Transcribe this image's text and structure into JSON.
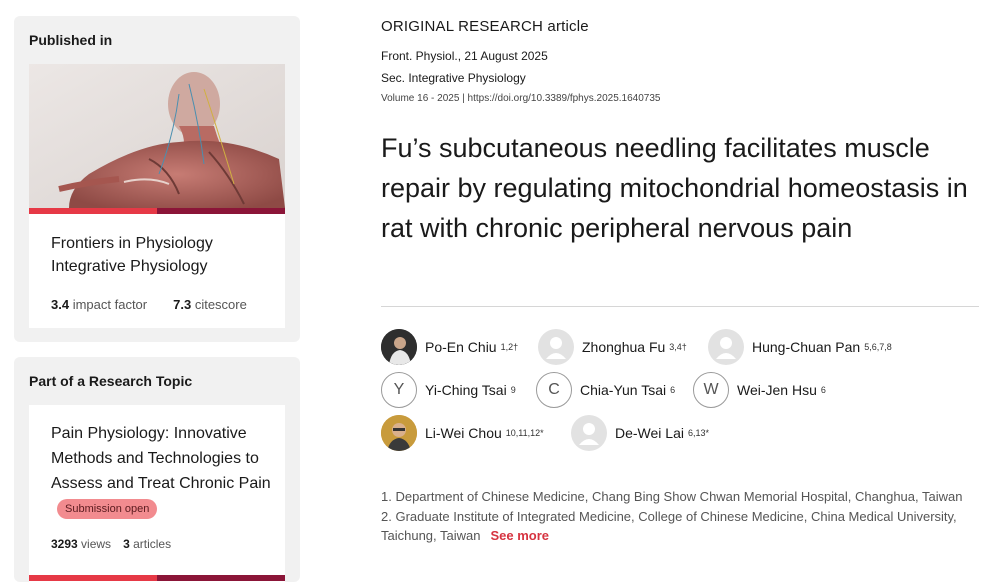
{
  "sidebar": {
    "published": {
      "heading": "Published in",
      "journal": "Frontiers in Physiology",
      "section": "Integrative Physiology",
      "impact_value": "3.4",
      "impact_label": "impact factor",
      "citescore_value": "7.3",
      "citescore_label": "citescore",
      "cover_icon": "anatomy-cover-image"
    },
    "topic": {
      "heading": "Part of a Research Topic",
      "title": "Pain Physiology: Innovative Methods and Technologies to Assess and Treat Chronic Pain",
      "badge": "Submission open",
      "views_value": "3293",
      "views_label": "views",
      "articles_value": "3",
      "articles_label": "articles"
    }
  },
  "article": {
    "type": "ORIGINAL RESEARCH article",
    "journal_date": "Front. Physiol., 21 August 2025",
    "section": "Sec. Integrative Physiology",
    "volume": "Volume 16 - 2025 |",
    "doi": "https://doi.org/10.3389/fphys.2025.1640735",
    "title": "Fu’s subcutaneous needling facilitates muscle repair by regulating mitochondrial homeostasis in rat with chronic peripheral nervous pain"
  },
  "authors": [
    {
      "name": "Po-En Chiu",
      "aff": "1,2†",
      "avatar": "photo"
    },
    {
      "name": "Zhonghua Fu",
      "aff": "3,4†",
      "avatar": "default"
    },
    {
      "name": "Hung-Chuan Pan",
      "aff": "5,6,7,8",
      "avatar": "default"
    },
    {
      "name": "Yi-Ching Tsai",
      "aff": "9",
      "avatar": "Y"
    },
    {
      "name": "Chia-Yun Tsai",
      "aff": "6",
      "avatar": "C"
    },
    {
      "name": "Wei-Jen Hsu",
      "aff": "6",
      "avatar": "W"
    },
    {
      "name": "Li-Wei Chou",
      "aff": "10,11,12*",
      "avatar": "photo"
    },
    {
      "name": "De-Wei Lai",
      "aff": "6,13*",
      "avatar": "default"
    }
  ],
  "affiliations": {
    "line1": "1. Department of Chinese Medicine, Chang Bing Show Chwan Memorial Hospital, Changhua, Taiwan",
    "line2": "2. Graduate Institute of Integrated Medicine, College of Chinese Medicine, China Medical University, Taichung, Taiwan",
    "see_more": "See more"
  },
  "colors": {
    "accent_red": "#e63946",
    "accent_dark": "#8b1538",
    "see_more": "#d63340",
    "badge_bg": "#f28b8f"
  }
}
